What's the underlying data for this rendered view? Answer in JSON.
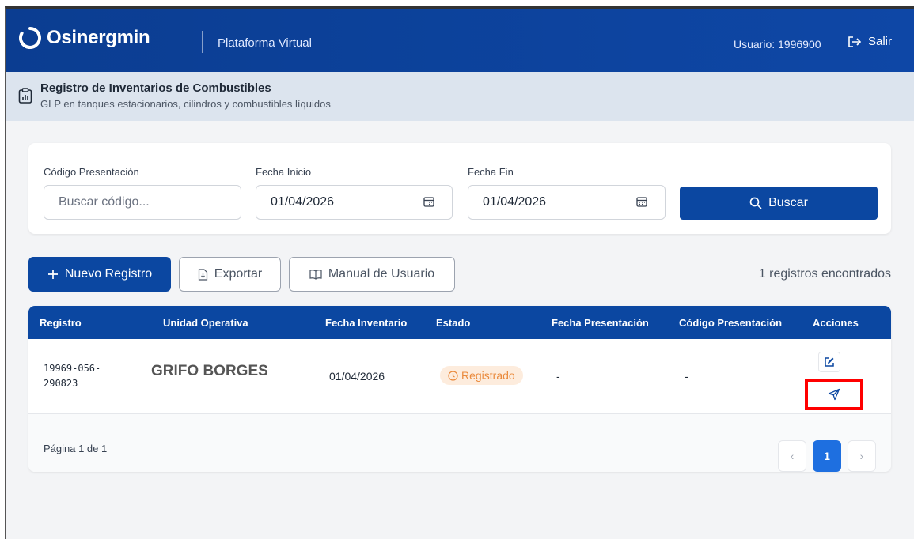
{
  "header": {
    "brand": "Osinergmin",
    "platform": "Plataforma Virtual",
    "user": "Usuario: 1996900",
    "logout_label": "Salir"
  },
  "subheader": {
    "title": "Registro de Inventarios de Combustibles",
    "description": "GLP en tanques estacionarios, cilindros y combustibles líquidos"
  },
  "filters": {
    "code_label": "Código Presentación",
    "code_placeholder": "Buscar código...",
    "start_label": "Fecha Inicio",
    "start_value": "01/04/2026",
    "end_label": "Fecha Fin",
    "end_value": "01/04/2026",
    "search_label": "Buscar"
  },
  "actions": {
    "new_label": "Nuevo Registro",
    "export_label": "Exportar",
    "manual_label": "Manual de Usuario",
    "count_text": "1 registros encontrados"
  },
  "table": {
    "columns": [
      "Registro",
      "Unidad Operativa",
      "Fecha Inventario",
      "Estado",
      "Fecha Presentación",
      "Código Presentación",
      "Acciones"
    ],
    "rows": [
      {
        "registro_line1": "19969-056-",
        "registro_line2": "290823",
        "unidad": "GRIFO BORGES",
        "fecha_inventario": "01/04/2026",
        "estado": "Registrado",
        "fecha_presentacion": "-",
        "codigo_presentacion": "-"
      }
    ]
  },
  "pagination": {
    "info": "Página 1 de 1",
    "prev": "‹",
    "current": "1",
    "next": "›"
  },
  "colors": {
    "primary": "#0b47a1",
    "badge_bg": "#fdecdd",
    "badge_text": "#ea8a3c",
    "highlight": "#ff0000"
  }
}
